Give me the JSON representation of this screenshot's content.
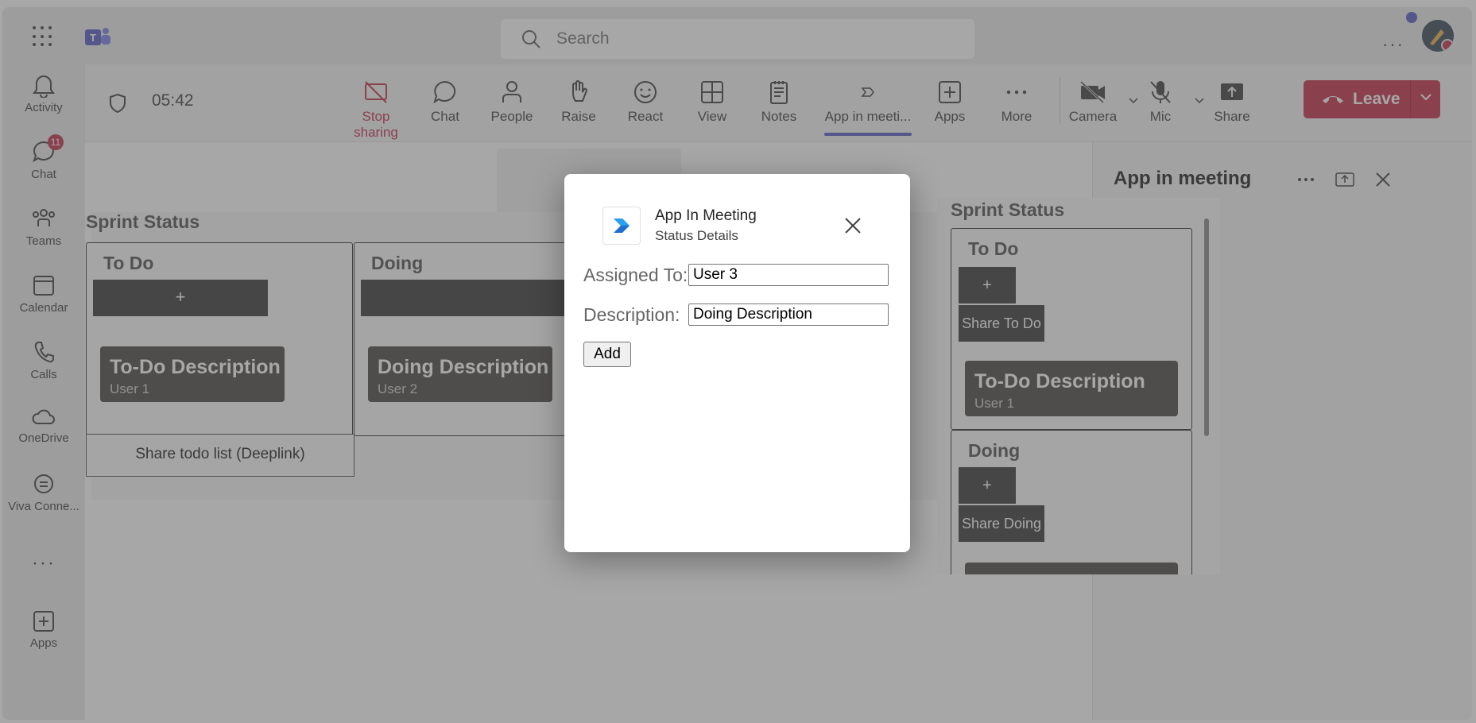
{
  "topbar": {
    "search_placeholder": "Search"
  },
  "rail": {
    "items": [
      {
        "label": "Activity"
      },
      {
        "label": "Chat",
        "badge": "11"
      },
      {
        "label": "Teams"
      },
      {
        "label": "Calendar"
      },
      {
        "label": "Calls"
      },
      {
        "label": "OneDrive"
      },
      {
        "label": "Viva Conne..."
      },
      {
        "label": "Apps"
      }
    ]
  },
  "toolbar": {
    "timer": "05:42",
    "buttons": {
      "stop_sharing": "Stop sharing",
      "chat": "Chat",
      "people": "People",
      "raise": "Raise",
      "react": "React",
      "view": "View",
      "notes": "Notes",
      "app_in_meeting": "App in meeti...",
      "apps": "Apps",
      "more": "More",
      "camera": "Camera",
      "mic": "Mic",
      "share": "Share"
    },
    "leave": "Leave",
    "accent_color": "#c4314b",
    "active_indicator_color": "#5b5fc7"
  },
  "stage": {
    "sprint_title": "Sprint Status",
    "columns": [
      {
        "title": "To Do",
        "plus": "+",
        "card": {
          "title": "To-Do Description",
          "user": "User 1"
        }
      },
      {
        "title": "Doing",
        "plus": "+",
        "card": {
          "title": "Doing Description",
          "user": "User 2"
        }
      }
    ],
    "share_deeplink": "Share todo list (Deeplink)"
  },
  "panel": {
    "title": "App in meeting",
    "sprint_title": "Sprint Status",
    "todo": {
      "title": "To Do",
      "plus": "+",
      "share": "Share To Do",
      "card": {
        "title": "To-Do Description",
        "user": "User 1"
      }
    },
    "doing": {
      "title": "Doing",
      "plus": "+",
      "share": "Share Doing"
    }
  },
  "dialog": {
    "app_name": "App In Meeting",
    "subtitle": "Status Details",
    "assigned_label": "Assigned To:",
    "assigned_value": "User 3",
    "description_label": "Description:",
    "description_value": "Doing Description",
    "add_button": "Add"
  }
}
